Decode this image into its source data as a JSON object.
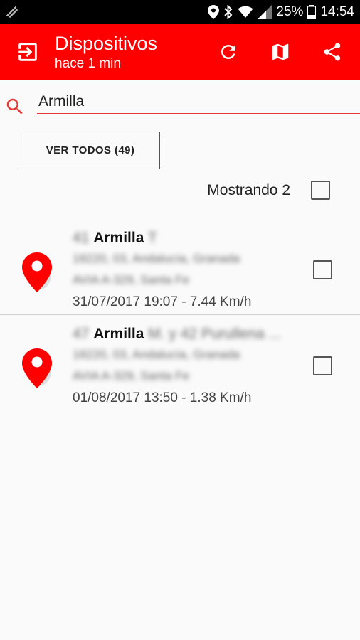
{
  "status_bar": {
    "battery": "25%",
    "time": "14:54",
    "icons": [
      "location-icon",
      "bluetooth-icon",
      "wifi-icon",
      "signal-icon",
      "battery-icon"
    ]
  },
  "app_bar": {
    "title": "Dispositivos",
    "subtitle": "hace 1 min",
    "icons": [
      "exit-icon",
      "refresh-icon",
      "map-icon",
      "share-icon"
    ],
    "color": "#ff0000"
  },
  "search": {
    "value": "Armilla",
    "icon": "search-icon"
  },
  "ver_todos_label": "VER TODOS (49)",
  "showing_label": "Mostrando 2",
  "devices": [
    {
      "prefix": "41",
      "name": "Armilla",
      "suffix": "T",
      "address1": "18220, 03, Andalucía, Granada",
      "address2": "AVIA A-329, Santa Fe",
      "datetime": "31/07/2017 19:07 - 7.44 Km/h"
    },
    {
      "prefix": "47",
      "name": "Armilla",
      "suffix": "M. y 42 Purullena ...",
      "address1": "18220, 03, Andalucía, Granada",
      "address2": "AVIA A-329, Santa Fe",
      "datetime": "01/08/2017 13:50 - 1.38 Km/h"
    }
  ],
  "accent_color": "#ff0000"
}
